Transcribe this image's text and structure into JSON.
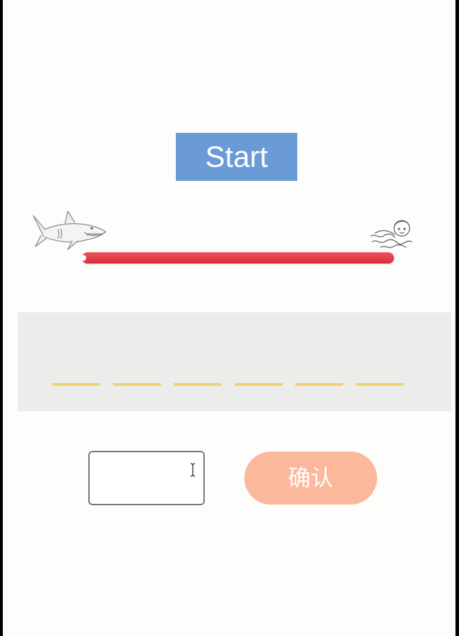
{
  "start_button": {
    "label": "Start"
  },
  "progress": {
    "fraction": 1.0
  },
  "word_blanks": {
    "count": 6
  },
  "answer_input": {
    "value": "",
    "placeholder": ""
  },
  "confirm_button": {
    "label": "确认"
  },
  "colors": {
    "start_button": "#6b9bd6",
    "progress_fill": "#e53e4c",
    "blank_line": "#f2d36b",
    "confirm_button": "#fbb89b",
    "panel": "#ececeb"
  },
  "icons": {
    "chaser": "shark-icon",
    "target": "swimmer-icon",
    "cursor": "text-cursor-icon"
  }
}
